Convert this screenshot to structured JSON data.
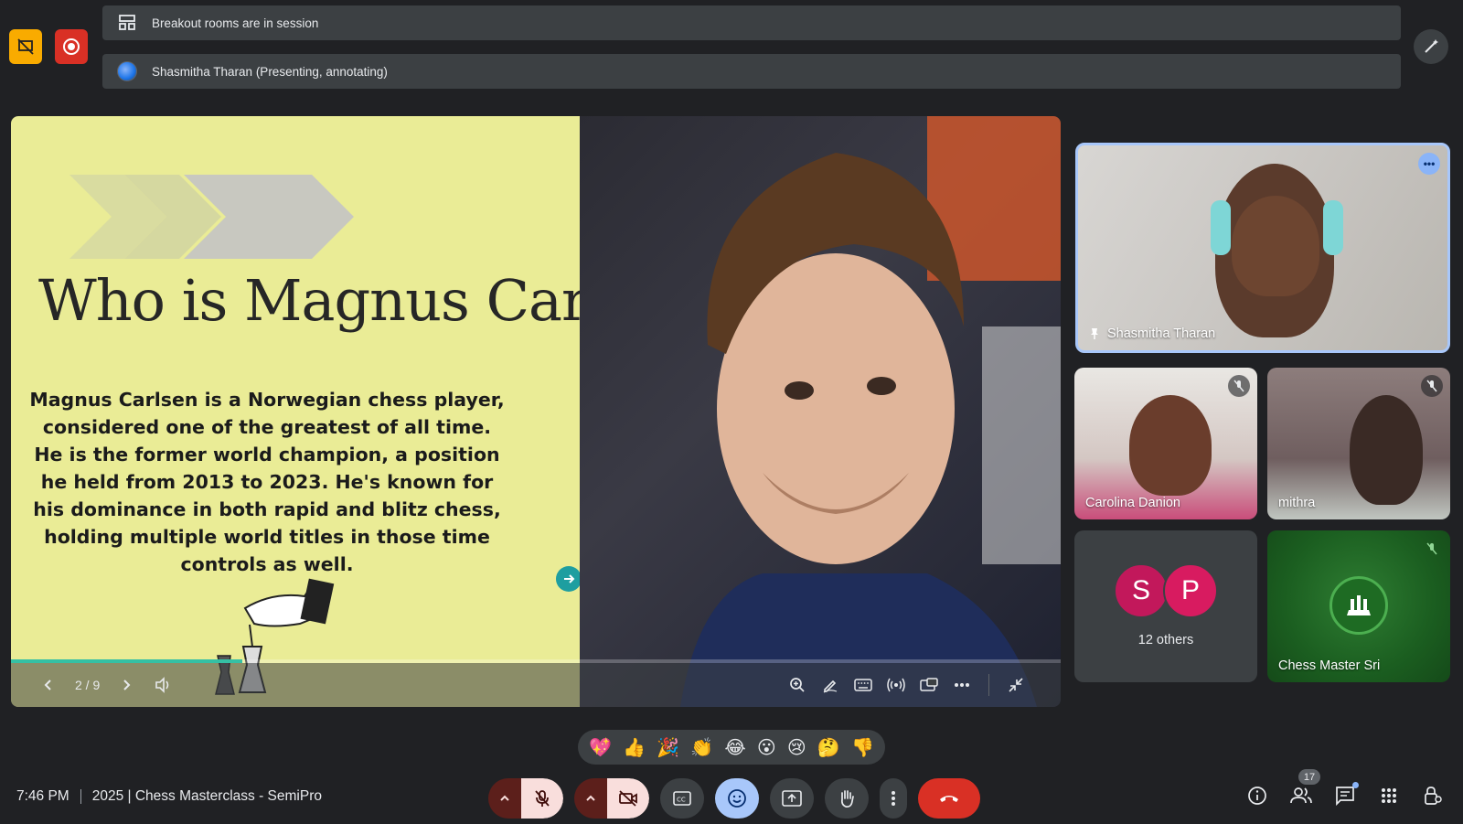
{
  "banners": {
    "breakout": "Breakout rooms are in session",
    "presenter": "Shasmitha Tharan (Presenting, annotating)"
  },
  "slide": {
    "title": "Who is Magnus Carlsen",
    "body": "Magnus Carlsen is a Norwegian chess player, considered one of the greatest of all time. He is the former world champion, a position he held from 2013 to 2023. He's known for his dominance in both rapid and blitz chess, holding multiple world titles in those time controls as well.",
    "page_indicator": "2 / 9",
    "current_page": 2,
    "total_pages": 9,
    "progress_fraction": 0.22
  },
  "participants": {
    "main_speaker": "Shasmitha Tharan",
    "tile_1": "Carolina Danion",
    "tile_2": "mithra",
    "others_initials": [
      "S",
      "P"
    ],
    "others_label": "12 others",
    "tile_host": "Chess Master Sri"
  },
  "reactions": [
    "💖",
    "👍",
    "🎉",
    "👏",
    "😂",
    "😮",
    "😢",
    "🤔",
    "👎"
  ],
  "meeting": {
    "time": "7:46 PM",
    "title": "2025 | Chess Masterclass - SemiPro"
  },
  "people_count": "17",
  "colors": {
    "accent_blue": "#a8c7fa",
    "end_call": "#d93025",
    "screenshare_indicator": "#f9ab00",
    "slide_bg": "#eaec96",
    "teal": "#1e9ea0"
  }
}
